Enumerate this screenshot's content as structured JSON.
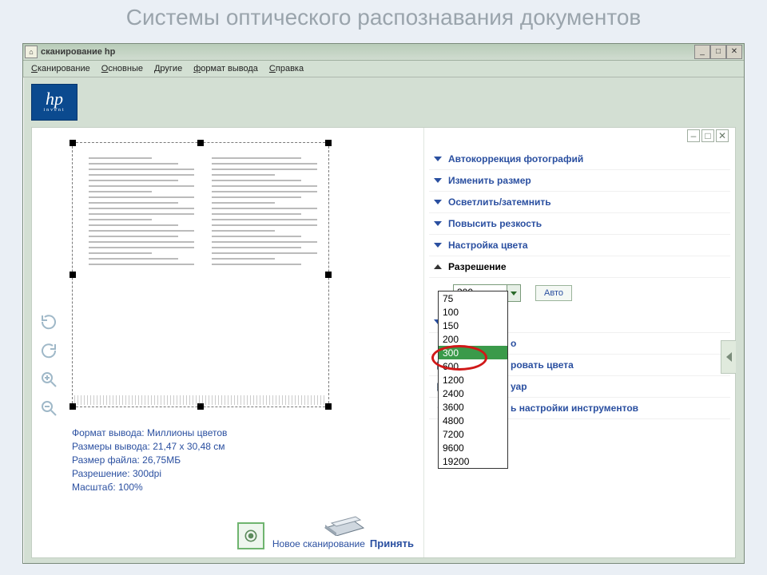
{
  "slide_title": "Системы оптического распознавания документов",
  "window": {
    "title": "сканирование hp",
    "menus": [
      "Сканирование",
      "Основные",
      "Другие",
      "формат вывода",
      "Справка"
    ],
    "logo_top": "hp",
    "logo_bottom": "invent"
  },
  "info": {
    "format_label": "Формат вывода: Миллионы цветов",
    "size_label": "Размеры вывода: 21,47 x 30,48 см",
    "file_label": "Размер файла: 26,75МБ",
    "res_label": "Разрешение:  300dpi",
    "scale_label": "Масштаб: 100%"
  },
  "actions": {
    "new_scan": "Новое сканирование",
    "accept": "Принять"
  },
  "accordion": {
    "autocorrect": "Автокоррекция фотографий",
    "resize": "Изменить размер",
    "lighten": "Осветлить/затемнить",
    "sharpen": "Повысить резкость",
    "color": "Настройка цвета",
    "resolution": "Разрешение",
    "auto_btn": "Авто",
    "combo_value": "300",
    "hidden1_suffix": "о",
    "hidden2_suffix": "ровать цвета",
    "hidden3_suffix": "уар",
    "hidden4_suffix": "ь настройки инструментов"
  },
  "dropdown": {
    "options": [
      "75",
      "100",
      "150",
      "200",
      "300",
      "600",
      "1200",
      "2400",
      "3600",
      "4800",
      "7200",
      "9600",
      "19200"
    ],
    "selected": "300"
  }
}
